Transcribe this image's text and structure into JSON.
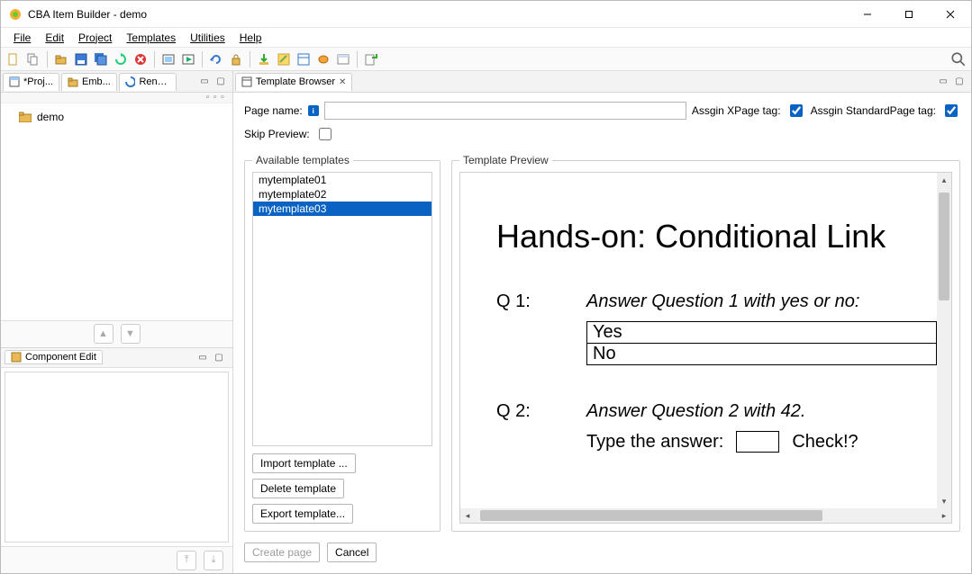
{
  "window": {
    "title": "CBA Item Builder - demo"
  },
  "menu": {
    "file": "File",
    "edit": "Edit",
    "project": "Project",
    "templates": "Templates",
    "utilities": "Utilities",
    "help": "Help"
  },
  "left_tabs": {
    "project": "*Proj...",
    "embedded": "Emb...",
    "render": "Rend..."
  },
  "tree": {
    "root": "demo"
  },
  "component_edit": {
    "title": "Component Edit"
  },
  "right_tab": {
    "title": "Template Browser"
  },
  "form": {
    "page_name_label": "Page name:",
    "page_name_value": "",
    "assign_xpage_label": "Assgin XPage tag:",
    "assign_xpage_checked": true,
    "assign_standard_label": "Assgin StandardPage tag:",
    "assign_standard_checked": true,
    "skip_preview_label": "Skip Preview:",
    "skip_preview_checked": false
  },
  "groups": {
    "available": "Available templates",
    "preview": "Template Preview"
  },
  "templates": {
    "items": [
      "mytemplate01",
      "mytemplate02",
      "mytemplate03"
    ],
    "selected_index": 2
  },
  "buttons": {
    "import": "Import template ...",
    "delete": "Delete template",
    "export": "Export template...",
    "create": "Create page",
    "cancel": "Cancel"
  },
  "preview": {
    "heading": "Hands-on: Conditional Link",
    "q1_label": "Q 1:",
    "q1_text": "Answer Question 1 with yes or no:",
    "q1_opt_yes": "Yes",
    "q1_opt_no": "No",
    "q2_label": "Q 2:",
    "q2_text": "Answer Question 2 with 42.",
    "type_label": "Type the answer:",
    "type_value": "",
    "check_label": "Check!?"
  }
}
